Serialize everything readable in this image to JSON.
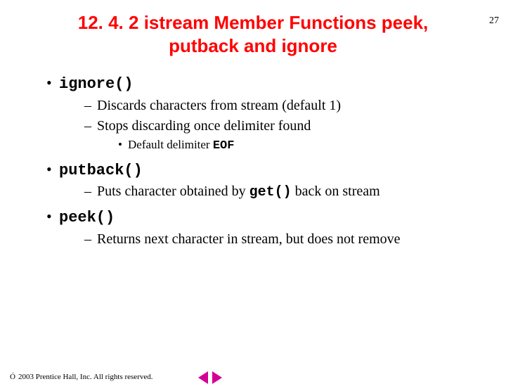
{
  "page_number": "27",
  "title_line1": "12. 4. 2 istream Member Functions peek,",
  "title_line2": "putback and ignore",
  "items": {
    "ignore": {
      "label": "ignore()",
      "sub1": "Discards characters from stream (default 1)",
      "sub2": "Stops discarding once delimiter found",
      "sub2_child_pre": "Default delimiter ",
      "sub2_child_code": "EOF"
    },
    "putback": {
      "label": "putback()",
      "sub1_pre": "Puts character obtained by ",
      "sub1_code": "get()",
      "sub1_post": " back on stream"
    },
    "peek": {
      "label": "peek()",
      "sub1": "Returns next character in stream, but does not remove"
    }
  },
  "footer": {
    "symbol": "Ó",
    "text": "2003 Prentice Hall, Inc. All rights reserved."
  },
  "nav": {
    "prev": "prev-slide",
    "next": "next-slide"
  }
}
